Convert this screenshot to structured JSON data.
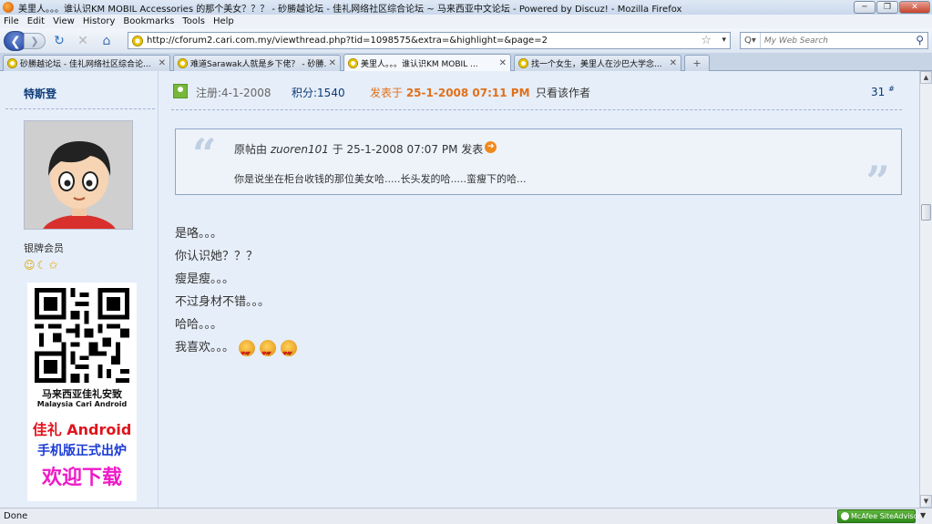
{
  "window": {
    "title": "美里人。。。谁认识KM MOBIL Accessories 的那个美女？？？ - 砂勝越论坛 - 佳礼网络社区综合论坛 ~ 马来西亚中文论坛 - Powered by Discuz! - Mozilla Firefox",
    "minimize_label": "─",
    "maximize_label": "❐",
    "close_label": "✕"
  },
  "menu": [
    "File",
    "Edit",
    "View",
    "History",
    "Bookmarks",
    "Tools",
    "Help"
  ],
  "nav": {
    "url": "http://cforum2.cari.com.my/viewthread.php?tid=1098575&extra=&highlight=&page=2",
    "search_placeholder": "My Web Search",
    "search_engine_label": "Q▾"
  },
  "tabs": [
    {
      "label": "砂勝越论坛 - 佳礼网络社区综合论...",
      "active": false
    },
    {
      "label": "难道Sarawak人就是乡下佬？ - 砂勝...",
      "active": false
    },
    {
      "label": "美里人。。。谁认识KM MOBIL ...",
      "active": true
    },
    {
      "label": "找一个女生，美里人在沙巴大学念...",
      "active": false
    }
  ],
  "sidebar": {
    "username": "特斯登",
    "rank": "银牌会员",
    "ad": {
      "line1": "马来西亚佳礼安致",
      "line2": "Malaysia Cari Android",
      "line3": "佳礼 Android",
      "line4": "手机版正式出炉",
      "line5": "欢迎下载"
    }
  },
  "post": {
    "register_label": "注册:4-1-2008",
    "points_label": "积分:1540",
    "posted_prefix": "发表于 ",
    "posted_time": "25-1-2008 07:11 PM",
    "author_only": "只看该作者",
    "floor": "31",
    "floor_sup": "#",
    "quote": {
      "prefix": "原帖由 ",
      "author": "zuoren101",
      "mid": " 于 25-1-2008 07:07 PM 发表",
      "body": "你是说坐在柜台收钱的那位美女哈.....长头发的哈.....蛮瘦下的哈..."
    },
    "lines": [
      "是咯。。。",
      "你认识她？？？",
      "瘦是瘦。。。",
      "不过身材不错。。。",
      "哈哈。。。",
      "我喜欢。。。"
    ]
  },
  "status": {
    "text": "Done",
    "mcafee_label": "McAfee SiteAdvisor"
  }
}
